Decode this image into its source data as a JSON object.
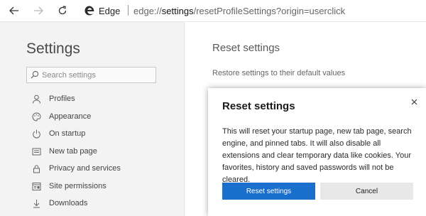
{
  "browser": {
    "site_name": "Edge",
    "url_prefix": "edge://",
    "url_host": "settings",
    "url_path": "/resetProfileSettings?origin=userclick"
  },
  "sidebar": {
    "title": "Settings",
    "search": {
      "placeholder": "Search settings",
      "value": ""
    },
    "items": [
      {
        "label": "Profiles",
        "icon": "person-icon"
      },
      {
        "label": "Appearance",
        "icon": "palette-icon"
      },
      {
        "label": "On startup",
        "icon": "power-icon"
      },
      {
        "label": "New tab page",
        "icon": "tab-page-icon"
      },
      {
        "label": "Privacy and services",
        "icon": "lock-icon"
      },
      {
        "label": "Site permissions",
        "icon": "site-permissions-icon"
      },
      {
        "label": "Downloads",
        "icon": "download-icon"
      }
    ]
  },
  "main": {
    "title": "Reset settings",
    "restore_label": "Restore settings to their default values"
  },
  "dialog": {
    "title": "Reset settings",
    "body": "This will reset your startup page, new tab page, search engine, and pinned tabs. It will also disable all extensions and clear temporary data like cookies. Your favorites, history and saved passwords will not be cleared.",
    "confirm_label": "Reset settings",
    "cancel_label": "Cancel"
  },
  "colors": {
    "accent": "#1a6fcc",
    "sidebar_bg": "#f3f3f3",
    "secondary_button": "#e8e8e8"
  }
}
